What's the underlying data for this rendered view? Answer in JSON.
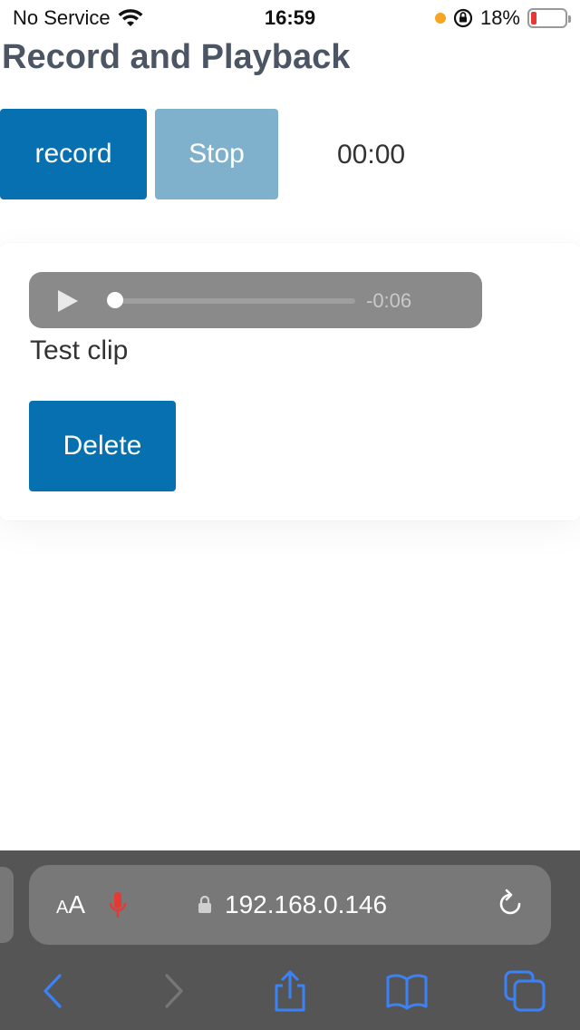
{
  "status_bar": {
    "carrier": "No Service",
    "time": "16:59",
    "battery_percent": "18%",
    "battery_level": 0.18,
    "icons": [
      "wifi-icon",
      "orange-dot",
      "orientation-lock-icon",
      "battery-icon"
    ]
  },
  "page": {
    "title": "Record and Playback"
  },
  "controls": {
    "record_label": "record",
    "stop_label": "Stop",
    "timer": "00:00"
  },
  "clip": {
    "remaining": "-0:06",
    "playback_progress": 0,
    "label": "Test clip",
    "delete_label": "Delete"
  },
  "browser": {
    "text_size_label_small": "A",
    "text_size_label_large": "A",
    "url": "192.168.0.146",
    "icons": [
      "mic-icon",
      "lock-icon",
      "reload-icon",
      "back-icon",
      "forward-icon",
      "share-icon",
      "bookmarks-icon",
      "tabs-icon"
    ]
  },
  "colors": {
    "primary_button": "#0770b1",
    "disabled_button": "#7fb0cc",
    "title": "#4b5563",
    "browser_chrome": "#555555",
    "browser_icons": "#3b82f6"
  }
}
